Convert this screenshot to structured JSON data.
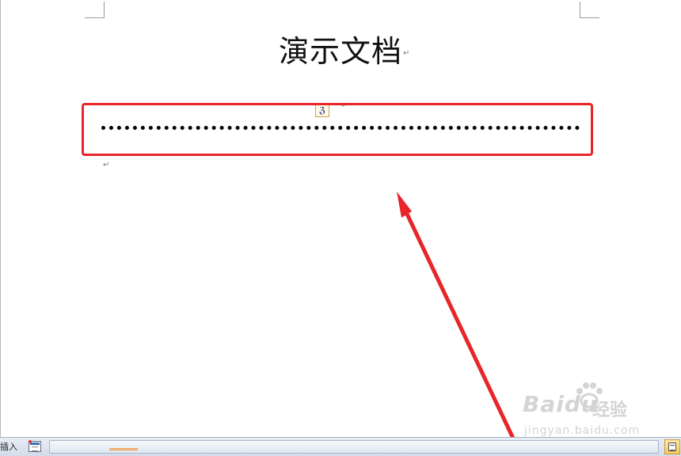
{
  "document": {
    "title": "演示文档",
    "paragraph_mark": "↵"
  },
  "autoformat": {
    "icon": "autocorrect-options-icon",
    "glyph": "ℨ"
  },
  "annotation": {
    "highlight_color": "#e8262a",
    "arrow_color": "#e8262a"
  },
  "watermark": {
    "logo": "Baidu",
    "subtitle": "经验",
    "url": "jingyan.baidu.com"
  },
  "statusbar": {
    "mode_label": "插入",
    "macro_icon": "macro-record-icon",
    "view_icon": "print-layout-view-icon"
  }
}
